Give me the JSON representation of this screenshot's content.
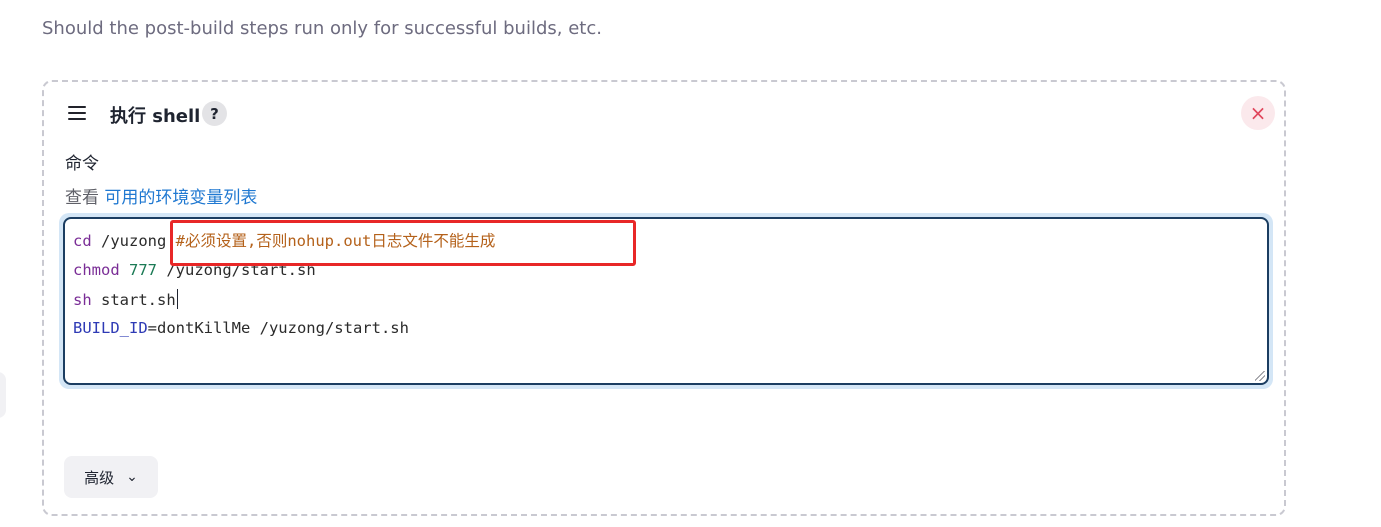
{
  "hint_text": "Should the post-build steps run only for successful builds, etc.",
  "build_step": {
    "title": "执行 shell",
    "help_label": "?",
    "close_label": "×",
    "command_label": "命令",
    "env_prefix": "查看",
    "env_link": "可用的环境变量列表",
    "code": {
      "line1": {
        "cmd": "cd",
        "arg": " /yuzong ",
        "comment": "#必须设置,否则nohup.out日志文件不能生成"
      },
      "line2": {
        "cmd": "chmod",
        "space": " ",
        "num": "777",
        "arg": " /yuzong/start.sh"
      },
      "line3": {
        "cmd": "sh",
        "arg": " start.sh"
      },
      "line4": {
        "var": "BUILD_ID",
        "arg": "=dontKillMe /yuzong/start.sh"
      }
    },
    "advanced_label": "高级",
    "advanced_icon": "⌄"
  },
  "colors": {
    "accent_link": "#1f78d1",
    "highlight_box": "#e82727",
    "editor_border": "#1b3d61",
    "close_icon": "#e0465c"
  },
  "icons": {
    "drag": "drag-handle-icon",
    "help": "question-icon",
    "close": "close-icon",
    "advanced": "chevron-down-icon"
  }
}
